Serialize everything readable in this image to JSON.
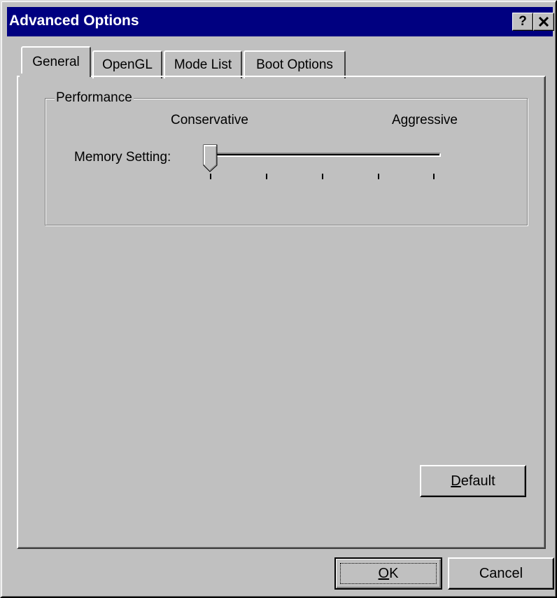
{
  "window": {
    "title": "Advanced Options",
    "help_button": "?",
    "colors": {
      "titlebar": "#000080",
      "face": "#c0c0c0"
    }
  },
  "tabs": [
    {
      "label": "General",
      "active": true
    },
    {
      "label": "OpenGL",
      "active": false
    },
    {
      "label": "Mode List",
      "active": false
    },
    {
      "label": "Boot Options",
      "active": false
    }
  ],
  "performance": {
    "group_label": "Performance",
    "left_label": "Conservative",
    "right_label": "Aggressive",
    "setting_label": "Memory Setting:",
    "slider": {
      "ticks": 5,
      "selected_index": 0
    }
  },
  "buttons": {
    "default_mnemonic": "D",
    "default_rest": "efault",
    "ok_mnemonic": "O",
    "ok_rest": "K",
    "cancel": "Cancel"
  }
}
